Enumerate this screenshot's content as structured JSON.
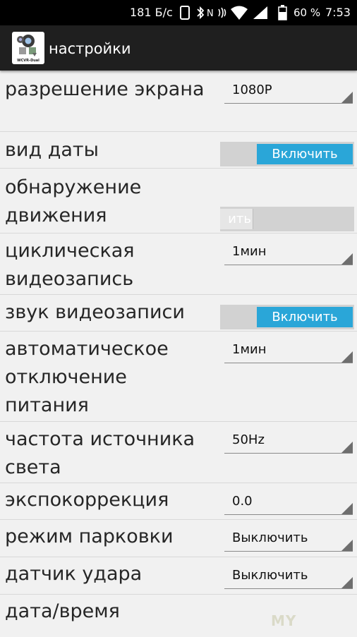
{
  "status_bar": {
    "network_speed": "181 Б/с",
    "battery_percent": "60 %",
    "time": "7:53",
    "icons": [
      "phone-icon",
      "bluetooth-icon",
      "nfc-icon",
      "vibrate-icon",
      "wifi-icon",
      "signal-icon",
      "battery-icon"
    ]
  },
  "app_bar": {
    "icon_label": "WCVR-Dual",
    "title": "настройки"
  },
  "settings": [
    {
      "label": "разрешение экрана",
      "control": "spinner",
      "value": "1080P"
    },
    {
      "label": "вид даты",
      "control": "toggle",
      "state": "on",
      "toggle_text": "Включить"
    },
    {
      "label": "обнаружение движения",
      "control": "toggle",
      "state": "off",
      "toggle_text": "ить"
    },
    {
      "label": "циклическая видеозапись",
      "control": "spinner",
      "value": "1мин"
    },
    {
      "label": "звук видеозаписи",
      "control": "toggle",
      "state": "on",
      "toggle_text": "Включить"
    },
    {
      "label": "автоматическое отключение питания",
      "control": "spinner",
      "value": "1мин"
    },
    {
      "label": "частота источника света",
      "control": "spinner",
      "value": "50Hz"
    },
    {
      "label": "экспокоррекция",
      "control": "spinner",
      "value": "0.0"
    },
    {
      "label": "режим парковки",
      "control": "spinner",
      "value": "Выключить"
    },
    {
      "label": "датчик удара",
      "control": "spinner",
      "value": "Выключить"
    },
    {
      "label": "дата/время",
      "control": "none"
    }
  ],
  "watermark": "MY"
}
